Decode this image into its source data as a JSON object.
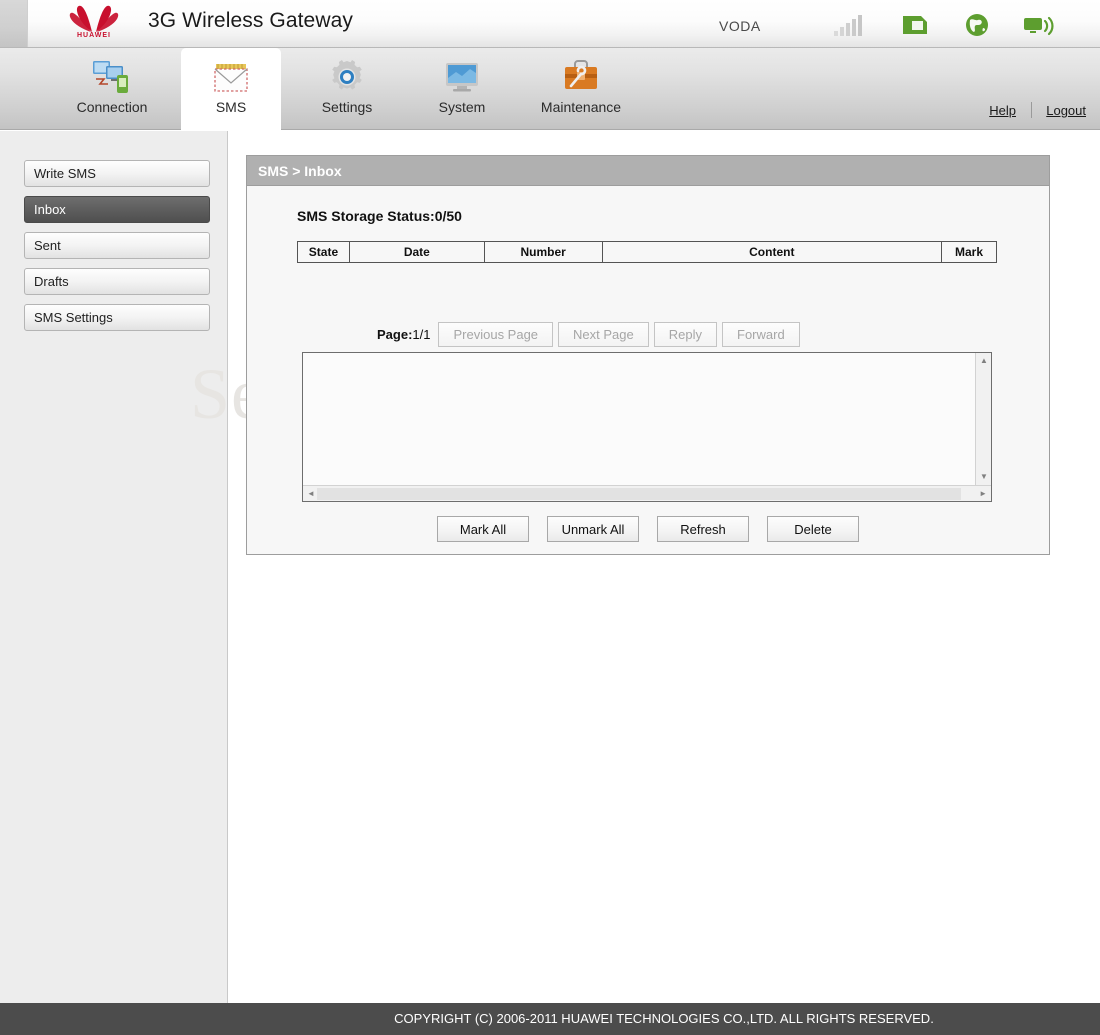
{
  "header": {
    "brand": "HUAWEI",
    "product_title": "3G Wireless Gateway",
    "carrier": "VODA",
    "status_icons": [
      {
        "name": "signal-bars-icon",
        "state": "inactive",
        "color": "#d5d5d5"
      },
      {
        "name": "sim-card-icon",
        "state": "active",
        "color": "#5d9e2f"
      },
      {
        "name": "globe-internet-icon",
        "state": "active",
        "color": "#5d9e2f"
      },
      {
        "name": "broadcast-monitor-icon",
        "state": "active",
        "color": "#5d9e2f"
      }
    ],
    "help_label": "Help",
    "logout_label": "Logout"
  },
  "tabs": [
    {
      "id": "connection",
      "label": "Connection",
      "icon": "computers-icon",
      "active": false
    },
    {
      "id": "sms",
      "label": "SMS",
      "icon": "envelope-icon",
      "active": true
    },
    {
      "id": "settings",
      "label": "Settings",
      "icon": "gear-icon",
      "active": false
    },
    {
      "id": "system",
      "label": "System",
      "icon": "monitor-icon",
      "active": false
    },
    {
      "id": "maintenance",
      "label": "Maintenance",
      "icon": "toolbox-icon",
      "active": false
    }
  ],
  "sidebar": {
    "items": [
      {
        "label": "Write SMS",
        "active": false
      },
      {
        "label": "Inbox",
        "active": true
      },
      {
        "label": "Sent",
        "active": false
      },
      {
        "label": "Drafts",
        "active": false
      },
      {
        "label": "SMS Settings",
        "active": false
      }
    ]
  },
  "watermark": {
    "text": "SetupRouter.com"
  },
  "panel": {
    "breadcrumb": "SMS > Inbox",
    "storage_status": "SMS Storage Status:0/50",
    "table": {
      "columns": [
        "State",
        "Date",
        "Number",
        "Content",
        "Mark"
      ],
      "rows": []
    },
    "pager": {
      "page_label": "Page:",
      "page_value": "1/1",
      "buttons": [
        {
          "label": "Previous Page",
          "disabled": true
        },
        {
          "label": "Next Page",
          "disabled": true
        },
        {
          "label": "Reply",
          "disabled": true
        },
        {
          "label": "Forward",
          "disabled": true
        }
      ]
    },
    "message_box": {
      "value": "",
      "scroll_up": "▲",
      "scroll_down": "▼",
      "scroll_left": "◄",
      "scroll_right": "►"
    },
    "actions": [
      {
        "label": "Mark All"
      },
      {
        "label": "Unmark All"
      },
      {
        "label": "Refresh"
      },
      {
        "label": "Delete"
      }
    ]
  },
  "footer": {
    "copyright": "COPYRIGHT (C) 2006-2011 HUAWEI TECHNOLOGIES CO.,LTD. ALL RIGHTS RESERVED."
  }
}
